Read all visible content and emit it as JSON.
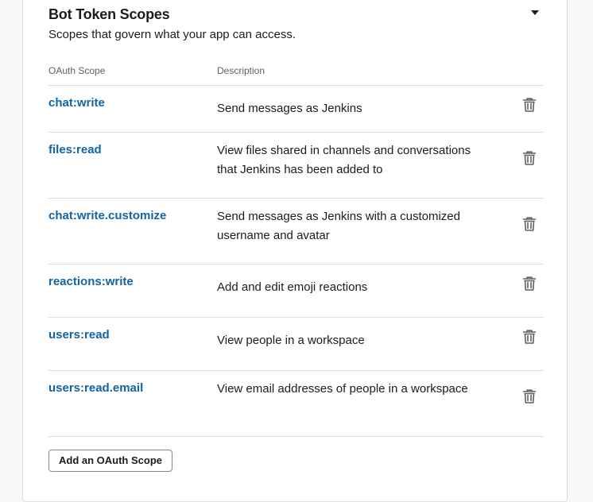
{
  "section": {
    "title": "Bot Token Scopes",
    "subtitle": "Scopes that govern what your app can access."
  },
  "table": {
    "columns": [
      "OAuth Scope",
      "Description"
    ],
    "rows": [
      {
        "scope": "chat:write",
        "description": "Send messages as Jenkins"
      },
      {
        "scope": "files:read",
        "description": "View files shared in channels and conversations that Jenkins has been added to"
      },
      {
        "scope": "chat:write.customize",
        "description": "Send messages as Jenkins with a customized username and avatar"
      },
      {
        "scope": "reactions:write",
        "description": "Add and edit emoji reactions"
      },
      {
        "scope": "users:read",
        "description": "View people in a workspace"
      },
      {
        "scope": "users:read.email",
        "description": "View email addresses of people in a workspace"
      }
    ]
  },
  "actions": {
    "add_scope_label": "Add an OAuth Scope"
  },
  "icons": {
    "collapse": "caret-down-icon",
    "remove": "trash-icon"
  },
  "colors": {
    "link": "#1264a3",
    "text": "#1d1c1d",
    "muted": "#616061",
    "border": "#dddddd"
  }
}
